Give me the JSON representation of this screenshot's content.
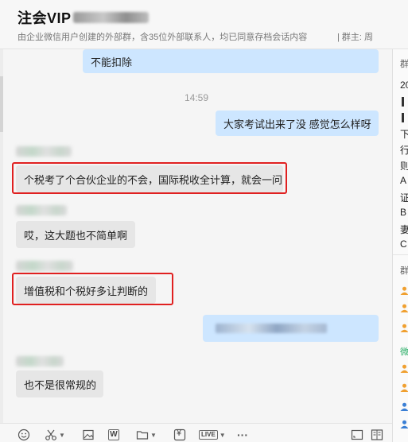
{
  "header": {
    "title": "注会VIP",
    "subtitle": "由企业微信用户创建的外部群，含35位外部联系人，均已同意存档会话内容",
    "owner_label": "| 群主: 周"
  },
  "messages": {
    "m1_text": "不能扣除",
    "time_1": "14:59",
    "m3_text": "大家考试出来了没 感觉怎么样呀",
    "m4_text": "个税考了个合伙企业的不会，国际税收全计算，就会一问",
    "m5_text": "哎，这大题也不简单啊",
    "m6_text": "增值税和个税好多让判断的",
    "m8_text": "也不是很常规的"
  },
  "right_panel": {
    "section_title": "群",
    "lines": [
      "20",
      "下",
      "行",
      "则",
      "A",
      "证",
      "B",
      "妻",
      "C"
    ],
    "members_title": "群",
    "wechat_label": "微"
  },
  "colors": {
    "outgoing_bubble": "#cde6ff",
    "incoming_bubble": "#e6e6e6",
    "highlight": "#e02020",
    "member_orange": "#f0a030",
    "member_blue": "#3a7fd5",
    "wechat_green": "#2aae67"
  },
  "toolbar": {
    "icons": [
      "emoji-icon",
      "scissors-icon",
      "image-icon",
      "word-icon",
      "folder-icon",
      "yen-icon",
      "live-icon",
      "more-icon",
      "screenshot-icon",
      "history-icon"
    ],
    "word_label": "W",
    "yen_label": "¥",
    "live_label": "LIVE",
    "more_label": "···"
  }
}
